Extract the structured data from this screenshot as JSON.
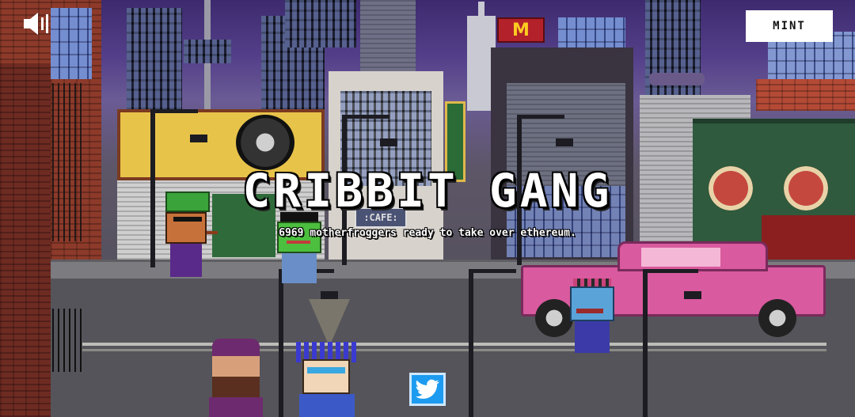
{
  "header": {
    "mint_label": "MINT",
    "sound_icon": "speaker-icon"
  },
  "hero": {
    "title": "CRIBBIT GANG",
    "subtitle": "6969 motherfroggers ready to take over ethereum."
  },
  "signs": {
    "cafe": ":CAFE:",
    "fastfood": "M"
  },
  "social": {
    "twitter_icon": "twitter-bird-icon"
  },
  "colors": {
    "sky": "#54408a",
    "title_text": "#ffffff",
    "mint_bg": "#ffffff",
    "twitter": "#1d9bf0",
    "car": "#d95a9e"
  }
}
